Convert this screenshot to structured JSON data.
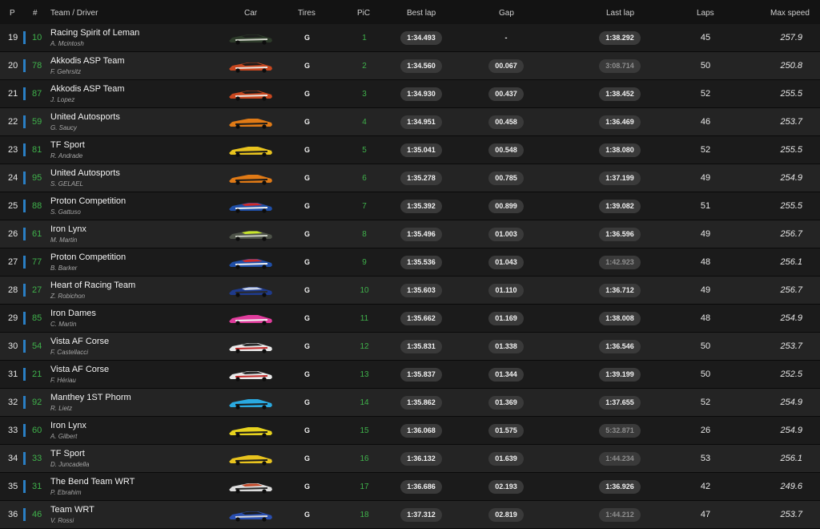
{
  "header": {
    "p": "P",
    "num": "#",
    "team_driver": "Team / Driver",
    "car": "Car",
    "tires": "Tires",
    "pic": "PiC",
    "best_lap": "Best lap",
    "gap": "Gap",
    "last_lap": "Last lap",
    "laps": "Laps",
    "max_speed": "Max speed"
  },
  "rows": [
    {
      "p": "19",
      "num": "10",
      "team": "Racing Spirit of Leman",
      "driver": "A. Mcintosh",
      "car_icon": "car-aston-green-icon",
      "livery": [
        "#2d3b2a",
        "#cfd3c8",
        "#1c1c1c"
      ],
      "tire": "G",
      "pic": "1",
      "best": "1:34.493",
      "gap": "-",
      "last": "1:38.292",
      "last_dim": false,
      "laps": "45",
      "speed": "257.9"
    },
    {
      "p": "20",
      "num": "78",
      "team": "Akkodis ASP Team",
      "driver": "F. Gehrsitz",
      "car_icon": "car-lexus-orange-icon",
      "livery": [
        "#c8471f",
        "#e9e4df",
        "#1a1a1a"
      ],
      "tire": "G",
      "pic": "2",
      "best": "1:34.560",
      "gap": "00.067",
      "last": "3:08.714",
      "last_dim": true,
      "laps": "50",
      "speed": "250.8"
    },
    {
      "p": "21",
      "num": "87",
      "team": "Akkodis ASP Team",
      "driver": "J. Lopez",
      "car_icon": "car-lexus-orange-icon",
      "livery": [
        "#c8471f",
        "#e9e4df",
        "#1a1a1a"
      ],
      "tire": "G",
      "pic": "3",
      "best": "1:34.930",
      "gap": "00.437",
      "last": "1:38.452",
      "last_dim": false,
      "laps": "52",
      "speed": "255.5"
    },
    {
      "p": "22",
      "num": "59",
      "team": "United Autosports",
      "driver": "G. Saucy",
      "car_icon": "car-mclaren-orange-icon",
      "livery": [
        "#e07a16",
        "#1a1a1a",
        "#e07a16"
      ],
      "tire": "G",
      "pic": "4",
      "best": "1:34.951",
      "gap": "00.458",
      "last": "1:36.469",
      "last_dim": false,
      "laps": "46",
      "speed": "253.7"
    },
    {
      "p": "23",
      "num": "81",
      "team": "TF Sport",
      "driver": "R. Andrade",
      "car_icon": "car-corvette-yellow-icon",
      "livery": [
        "#e8c31e",
        "#1a1a1a",
        "#e8c31e"
      ],
      "tire": "G",
      "pic": "5",
      "best": "1:35.041",
      "gap": "00.548",
      "last": "1:38.080",
      "last_dim": false,
      "laps": "52",
      "speed": "255.5"
    },
    {
      "p": "24",
      "num": "95",
      "team": "United Autosports",
      "driver": "S. GELAEL",
      "car_icon": "car-mclaren-orange-icon",
      "livery": [
        "#e07a16",
        "#1a1a1a",
        "#e07a16"
      ],
      "tire": "G",
      "pic": "6",
      "best": "1:35.278",
      "gap": "00.785",
      "last": "1:37.199",
      "last_dim": false,
      "laps": "49",
      "speed": "254.9"
    },
    {
      "p": "25",
      "num": "88",
      "team": "Proton Competition",
      "driver": "S. Gattuso",
      "car_icon": "car-ford-blue-white-icon",
      "livery": [
        "#1f4fa8",
        "#f0f0f0",
        "#d02a2a"
      ],
      "tire": "G",
      "pic": "7",
      "best": "1:35.392",
      "gap": "00.899",
      "last": "1:39.082",
      "last_dim": false,
      "laps": "51",
      "speed": "255.5"
    },
    {
      "p": "26",
      "num": "61",
      "team": "Iron Lynx",
      "driver": "M. Martin",
      "car_icon": "car-mercedes-camo-icon",
      "livery": [
        "#4d5248",
        "#c9cdc2",
        "#c8e62a"
      ],
      "tire": "G",
      "pic": "8",
      "best": "1:35.496",
      "gap": "01.003",
      "last": "1:36.596",
      "last_dim": false,
      "laps": "49",
      "speed": "256.7"
    },
    {
      "p": "27",
      "num": "77",
      "team": "Proton Competition",
      "driver": "B. Barker",
      "car_icon": "car-ford-blue-white-icon",
      "livery": [
        "#1f4fa8",
        "#f0f0f0",
        "#d02a2a"
      ],
      "tire": "G",
      "pic": "9",
      "best": "1:35.536",
      "gap": "01.043",
      "last": "1:42.923",
      "last_dim": true,
      "laps": "48",
      "speed": "256.1"
    },
    {
      "p": "28",
      "num": "27",
      "team": "Heart of Racing Team",
      "driver": "Z. Robichon",
      "car_icon": "car-aston-blue-icon",
      "livery": [
        "#1e3a8c",
        "#2a2a2a",
        "#c9d3e8"
      ],
      "tire": "G",
      "pic": "10",
      "best": "1:35.603",
      "gap": "01.110",
      "last": "1:36.712",
      "last_dim": false,
      "laps": "49",
      "speed": "256.7"
    },
    {
      "p": "29",
      "num": "85",
      "team": "Iron Dames",
      "driver": "C. Martin",
      "car_icon": "car-porsche-pink-icon",
      "livery": [
        "#e03c9c",
        "#f2f2f2",
        "#e03c9c"
      ],
      "tire": "G",
      "pic": "11",
      "best": "1:35.662",
      "gap": "01.169",
      "last": "1:38.008",
      "last_dim": false,
      "laps": "48",
      "speed": "254.9"
    },
    {
      "p": "30",
      "num": "54",
      "team": "Vista AF Corse",
      "driver": "F. Castellacci",
      "car_icon": "car-ferrari-white-icon",
      "livery": [
        "#e8e8e8",
        "#c52a2a",
        "#2a2a2a"
      ],
      "tire": "G",
      "pic": "12",
      "best": "1:35.831",
      "gap": "01.338",
      "last": "1:36.546",
      "last_dim": false,
      "laps": "50",
      "speed": "253.7"
    },
    {
      "p": "31",
      "num": "21",
      "team": "Vista AF Corse",
      "driver": "F. Hériau",
      "car_icon": "car-ferrari-white-icon",
      "livery": [
        "#e8e8e8",
        "#c52a2a",
        "#2a2a2a"
      ],
      "tire": "G",
      "pic": "13",
      "best": "1:35.837",
      "gap": "01.344",
      "last": "1:39.199",
      "last_dim": false,
      "laps": "50",
      "speed": "252.5"
    },
    {
      "p": "32",
      "num": "92",
      "team": "Manthey 1ST Phorm",
      "driver": "R. Lietz",
      "car_icon": "car-porsche-cyan-icon",
      "livery": [
        "#2aa9e0",
        "#1a1a1a",
        "#2aa9e0"
      ],
      "tire": "G",
      "pic": "14",
      "best": "1:35.862",
      "gap": "01.369",
      "last": "1:37.655",
      "last_dim": false,
      "laps": "52",
      "speed": "254.9"
    },
    {
      "p": "33",
      "num": "60",
      "team": "Iron Lynx",
      "driver": "A. Gilbert",
      "car_icon": "car-mercedes-yellow-icon",
      "livery": [
        "#e6d21e",
        "#1a1a1a",
        "#e6d21e"
      ],
      "tire": "G",
      "pic": "15",
      "best": "1:36.068",
      "gap": "01.575",
      "last": "5:32.871",
      "last_dim": true,
      "laps": "26",
      "speed": "254.9"
    },
    {
      "p": "34",
      "num": "33",
      "team": "TF Sport",
      "driver": "D. Juncadella",
      "car_icon": "car-corvette-yellow-icon",
      "livery": [
        "#e8c31e",
        "#1a1a1a",
        "#e8c31e"
      ],
      "tire": "G",
      "pic": "16",
      "best": "1:36.132",
      "gap": "01.639",
      "last": "1:44.234",
      "last_dim": true,
      "laps": "53",
      "speed": "256.1"
    },
    {
      "p": "35",
      "num": "31",
      "team": "The Bend Team WRT",
      "driver": "P. Ebrahim",
      "car_icon": "car-bmw-white-icon",
      "livery": [
        "#dcdcdc",
        "#2a2a2a",
        "#c44a2a"
      ],
      "tire": "G",
      "pic": "17",
      "best": "1:36.686",
      "gap": "02.193",
      "last": "1:36.926",
      "last_dim": false,
      "laps": "42",
      "speed": "249.6"
    },
    {
      "p": "36",
      "num": "46",
      "team": "Team WRT",
      "driver": "V. Rossi",
      "car_icon": "car-bmw-blue-icon",
      "livery": [
        "#2a4fb0",
        "#d8d8d8",
        "#1a1a1a"
      ],
      "tire": "G",
      "pic": "18",
      "best": "1:37.312",
      "gap": "02.819",
      "last": "1:44.212",
      "last_dim": true,
      "laps": "47",
      "speed": "253.7"
    }
  ]
}
